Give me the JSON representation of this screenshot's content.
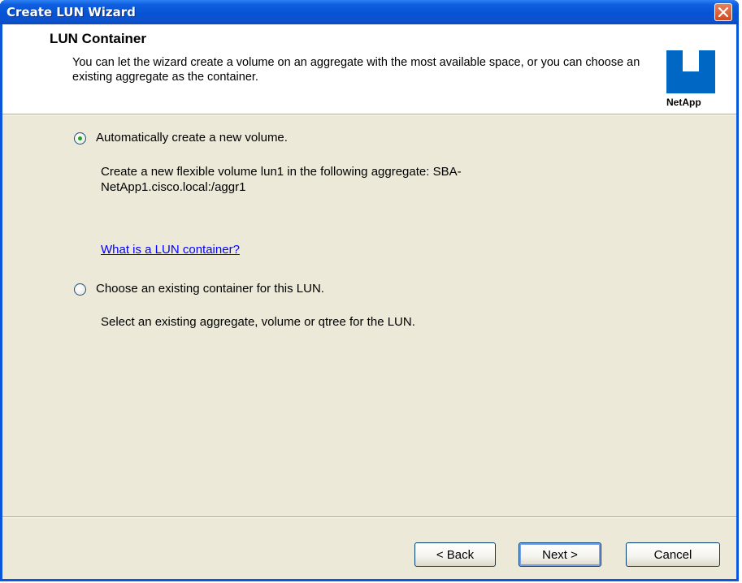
{
  "window": {
    "title": "Create LUN Wizard",
    "close_icon": "close-icon"
  },
  "header": {
    "title": "LUN Container",
    "description": "You can let the wizard create a volume on an aggregate with the most available space, or you can choose an existing aggregate as the container.",
    "logo_text": "NetApp"
  },
  "options": [
    {
      "label": "Automatically create a new volume.",
      "selected": true,
      "description": "Create a new flexible volume lun1 in the following aggregate: SBA-NetApp1.cisco.local:/aggr1"
    },
    {
      "label": "Choose an existing container for this LUN.",
      "selected": false,
      "description": "Select an existing aggregate, volume or qtree for the LUN."
    }
  ],
  "help_link": "What is a LUN container?",
  "buttons": {
    "back": "< Back",
    "next": "Next >",
    "cancel": "Cancel"
  },
  "colors": {
    "titlebar": "#0753d6",
    "dialog_bg": "#ece9d8",
    "link": "#0000ff",
    "logo": "#0067c5"
  }
}
